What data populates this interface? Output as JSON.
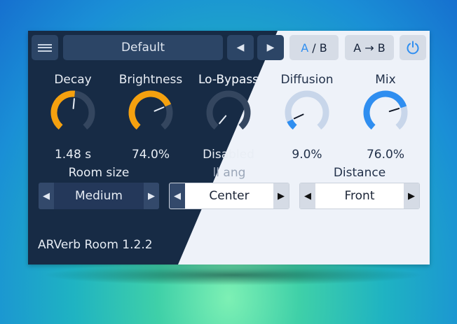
{
  "plugin": {
    "name_version": "ARVerb Room 1.2.2"
  },
  "toolbar": {
    "preset_name": "Default",
    "prev_glyph": "◀",
    "next_glyph": "▶",
    "ab_a": "A",
    "ab_sep": " / ",
    "ab_b": "B",
    "copy_label": "A → B"
  },
  "knobs": [
    {
      "label": "Decay",
      "value": "1.48 s",
      "fraction": 0.52
    },
    {
      "label": "Brightness",
      "value": "74.0%",
      "fraction": 0.74
    },
    {
      "label": "Lo-Bypass",
      "value": "Disabled",
      "fraction": 0.0
    },
    {
      "label": "Diffusion",
      "value": "9.0%",
      "fraction": 0.09
    },
    {
      "label": "Mix",
      "value": "76.0%",
      "fraction": 0.76
    }
  ],
  "selectors": [
    {
      "title": "Room size",
      "value": "Medium"
    },
    {
      "title": "ll ang",
      "value": "Center"
    },
    {
      "title": "Distance",
      "value": "Front"
    }
  ],
  "colors": {
    "accent_orange": "#f5a10f",
    "accent_blue": "#2f8ef0",
    "dark_bg": "#172b45",
    "light_bg": "#eef2f9"
  }
}
